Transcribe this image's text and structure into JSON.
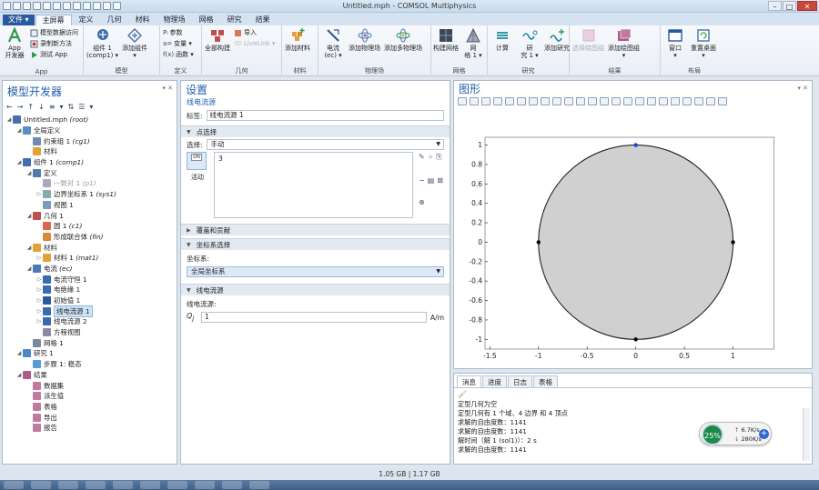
{
  "window": {
    "title": "Untitled.mph - COMSOL Multiphysics"
  },
  "ribbon_tabs": {
    "file": "文件 ▾",
    "items": [
      "主屏幕",
      "定义",
      "几何",
      "材料",
      "物理场",
      "网格",
      "研究",
      "结果"
    ]
  },
  "ribbon": {
    "app": {
      "builder": "App\n开发器",
      "data_access": "模型数据访问",
      "record": "录制新方法",
      "test": "测试 App",
      "label": "App"
    },
    "model": {
      "component": "组件 1\n(comp1) ▾",
      "add_component": "添加组件\n▾",
      "label": "模型"
    },
    "definitions": {
      "params": "参数",
      "variables": "变量 ▾",
      "functions": "函数 ▾",
      "label": "定义"
    },
    "geometry": {
      "build_all": "全部构建",
      "import": "导入",
      "livelink": "LiveLink ▾",
      "label": "几何"
    },
    "materials": {
      "add": "添加材料",
      "label": "材料"
    },
    "physics": {
      "current": "电流\n(ec) ▾",
      "add_physics": "添加物理场",
      "add_multi": "添加多物理场",
      "label": "物理场"
    },
    "mesh": {
      "build_mesh": "构建网格",
      "mesh1": "网\n格 1 ▾",
      "label": "网格"
    },
    "study": {
      "compute": "计算",
      "study1": "研\n究 1 ▾",
      "add_study": "添加研究",
      "label": "研究"
    },
    "results": {
      "select_plot": "选择绘图组",
      "add_plot": "添加绘图组\n▾",
      "label": "结果"
    },
    "layout": {
      "window": "窗口\n▾",
      "reset": "重置桌面\n▾",
      "label": "布局"
    }
  },
  "model_builder": {
    "title": "模型开发器",
    "tree": [
      {
        "label": "Untitled.mph",
        "suffix": " (root)",
        "depth": 0,
        "tw": "◢",
        "color": "#4a6fa5"
      },
      {
        "label": "全局定义",
        "suffix": "",
        "depth": 1,
        "tw": "◢",
        "color": "#5b8fc8"
      },
      {
        "label": "约束组 1",
        "suffix": " (cg1)",
        "depth": 2,
        "tw": "",
        "color": "#6a8cb5"
      },
      {
        "label": "材料",
        "suffix": "",
        "depth": 2,
        "tw": "",
        "color": "#e2a23a"
      },
      {
        "label": "组件 1",
        "suffix": " (comp1)",
        "depth": 1,
        "tw": "◢",
        "color": "#3d6fb0"
      },
      {
        "label": "定义",
        "suffix": "",
        "depth": 2,
        "tw": "◢",
        "color": "#5577aa"
      },
      {
        "label": "一致对 1",
        "suffix": " (p1)",
        "depth": 3,
        "tw": "",
        "color": "#aab",
        "dim": true
      },
      {
        "label": "边界坐标系 1",
        "suffix": " (sys1)",
        "depth": 3,
        "tw": "▷",
        "color": "#8aa"
      },
      {
        "label": "视图 1",
        "suffix": "",
        "depth": 3,
        "tw": "",
        "color": "#7a9bc0"
      },
      {
        "label": "几何 1",
        "suffix": "",
        "depth": 2,
        "tw": "◢",
        "color": "#c0504d"
      },
      {
        "label": "圆 1",
        "suffix": " (c1)",
        "depth": 3,
        "tw": "",
        "color": "#d86a4a"
      },
      {
        "label": "形成联合体",
        "suffix": " (fin)",
        "depth": 3,
        "tw": "",
        "color": "#d88a3a"
      },
      {
        "label": "材料",
        "suffix": "",
        "depth": 2,
        "tw": "◢",
        "color": "#e2a23a"
      },
      {
        "label": "材料 1",
        "suffix": " (mat1)",
        "depth": 3,
        "tw": "▷",
        "color": "#e2a23a"
      },
      {
        "label": "电流",
        "suffix": " (ec)",
        "depth": 2,
        "tw": "◢",
        "color": "#4a7ab8"
      },
      {
        "label": "电流守恒 1",
        "suffix": "",
        "depth": 3,
        "tw": "▷",
        "color": "#3a6ab0"
      },
      {
        "label": "电绝缘 1",
        "suffix": "",
        "depth": 3,
        "tw": "▷",
        "color": "#3a6ab0"
      },
      {
        "label": "初始值 1",
        "suffix": "",
        "depth": 3,
        "tw": "▷",
        "color": "#2a5a9e"
      },
      {
        "label": "线电流源 1",
        "suffix": "",
        "depth": 3,
        "tw": "▷",
        "color": "#3a6ab0",
        "selected": true
      },
      {
        "label": "线电流源 2",
        "suffix": "",
        "depth": 3,
        "tw": "▷",
        "color": "#3a6ab0"
      },
      {
        "label": "方程视图",
        "suffix": "",
        "depth": 3,
        "tw": "",
        "color": "#8a8aa8"
      },
      {
        "label": "网格 1",
        "suffix": "",
        "depth": 2,
        "tw": "",
        "color": "#7a8a9a"
      },
      {
        "label": "研究 1",
        "suffix": "",
        "depth": 1,
        "tw": "◢",
        "color": "#4a8ac8"
      },
      {
        "label": "步骤 1: 稳态",
        "suffix": "",
        "depth": 2,
        "tw": "",
        "color": "#5a9ad8"
      },
      {
        "label": "结果",
        "suffix": "",
        "depth": 1,
        "tw": "◢",
        "color": "#b05a8a"
      },
      {
        "label": "数据集",
        "suffix": "",
        "depth": 2,
        "tw": "",
        "color": "#c07aa0"
      },
      {
        "label": "派生值",
        "suffix": "",
        "depth": 2,
        "tw": "",
        "color": "#c07aa0"
      },
      {
        "label": "表格",
        "suffix": "",
        "depth": 2,
        "tw": "",
        "color": "#c07aa0"
      },
      {
        "label": "导出",
        "suffix": "",
        "depth": 2,
        "tw": "",
        "color": "#c07aa0"
      },
      {
        "label": "报告",
        "suffix": "",
        "depth": 2,
        "tw": "",
        "color": "#c07aa0"
      }
    ]
  },
  "settings": {
    "title": "设置",
    "subtitle": "线电流源",
    "label_caption": "标签:",
    "label_value": "线电流源 1",
    "point_selection": "点选择",
    "selection_caption": "选择:",
    "selection_value": "手动",
    "selection_list_item": "3",
    "active_label": "活动",
    "active_badge": "ON",
    "override": "覆盖和贡献",
    "coord_section": "坐标系选择",
    "coord_caption": "坐标系:",
    "coord_value": "全局坐标系",
    "line_current_section": "线电流源",
    "line_current_caption": "线电流源:",
    "qj_symbol": "Q",
    "qj_sub": "j",
    "qj_value": "1",
    "qj_unit": "A/m"
  },
  "graphics": {
    "title": "图形",
    "chart_data": {
      "type": "scatter",
      "x_ticks": [
        "-1.5",
        "-1",
        "-0.5",
        "0",
        "0.5",
        "1"
      ],
      "x_tick_values": [
        -1.5,
        -1,
        -0.5,
        0,
        0.5,
        1
      ],
      "y_ticks": [
        "1",
        "0.8",
        "0.6",
        "0.4",
        "0.2",
        "0",
        "-0.2",
        "-0.4",
        "-0.6",
        "-0.8",
        "-1"
      ],
      "y_tick_values": [
        1,
        0.8,
        0.6,
        0.4,
        0.2,
        0,
        -0.2,
        -0.4,
        -0.6,
        -0.8,
        -1
      ],
      "xlim": [
        -1.55,
        1.42
      ],
      "ylim": [
        -1.1,
        1.08
      ],
      "circle": {
        "cx": 0,
        "cy": 0,
        "r": 1,
        "fill": "#d0d0d0",
        "stroke": "#222222"
      },
      "vertices": [
        {
          "x": 0,
          "y": 1,
          "selected": true
        },
        {
          "x": -1,
          "y": 0,
          "selected": false
        },
        {
          "x": 1,
          "y": 0,
          "selected": false
        },
        {
          "x": 0,
          "y": -1,
          "selected": false
        }
      ],
      "selected_color": "#1a3fd0",
      "vertex_color": "#000000"
    }
  },
  "messages": {
    "tabs": [
      "消息",
      "进度",
      "日志",
      "表格"
    ],
    "lines": [
      "定型几何为空",
      "定型几何有 1 个域、4 边界 和 4 顶点",
      "求解的自由度数：1141",
      "求解的自由度数：1141",
      "解时间（解 1 (sol1)）：2 s",
      "求解的自由度数：1141"
    ]
  },
  "net_widget": {
    "percent": "25%",
    "up": "6.7K/s",
    "down": "280K/s",
    "plus": "+"
  },
  "status_bar": {
    "memory": "1.05 GB | 1.17 GB"
  },
  "colors": {
    "accent": "#1f5fa8",
    "file_tab": "#2a5a9e"
  }
}
